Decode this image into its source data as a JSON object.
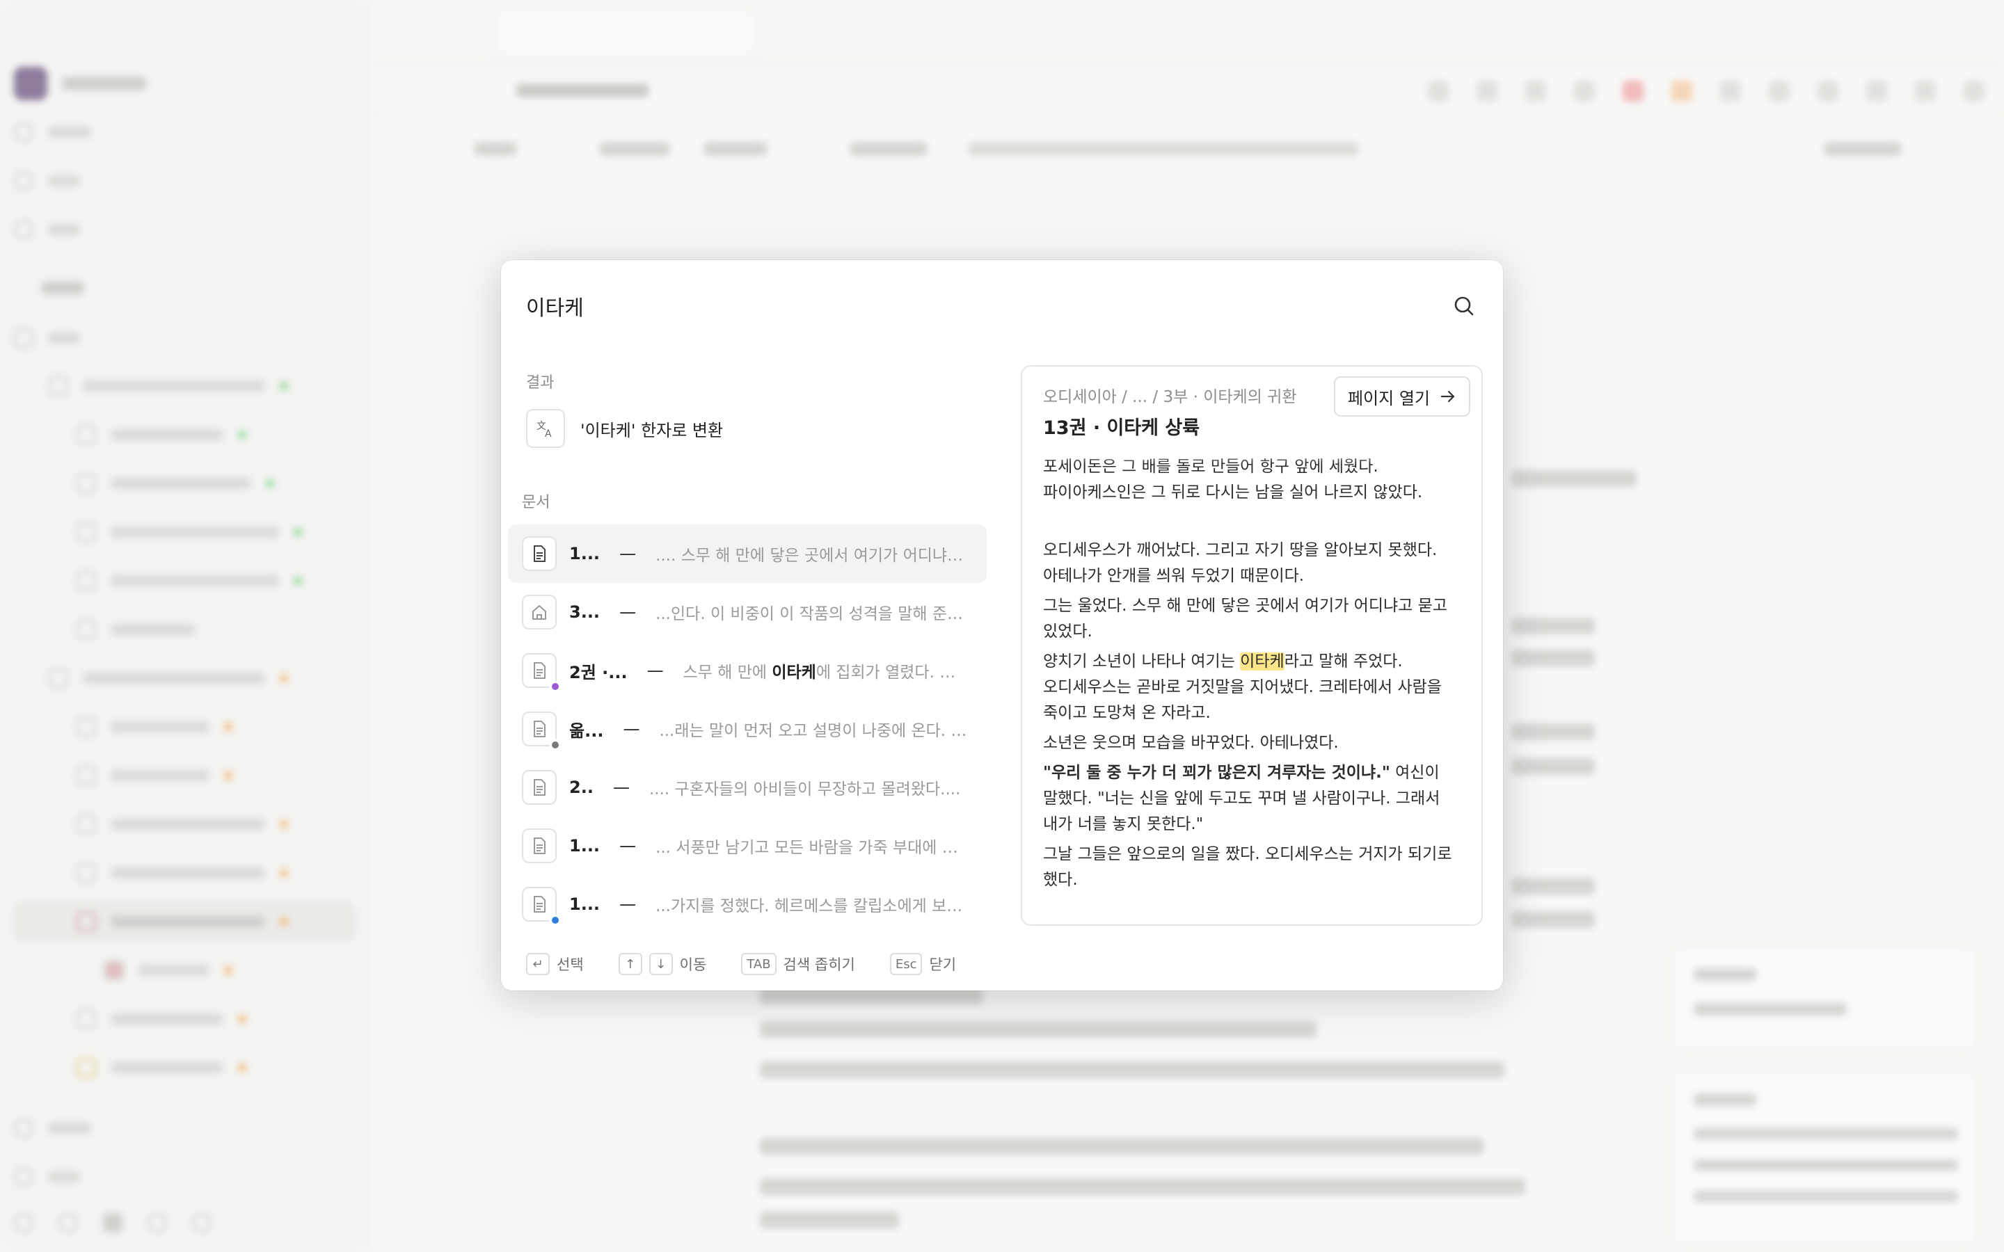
{
  "search": {
    "query": "이타케"
  },
  "sections": {
    "results_label": "결과",
    "documents_label": "문서"
  },
  "convert": {
    "label": "'이타케' 한자로 변환",
    "icon": "translate-icon"
  },
  "results": [
    {
      "title": "1...",
      "snippet": ".... 스무 해 만에 닿은 곳에서 여기가 어디냐고...",
      "icon": "document-icon",
      "status": null,
      "active": true
    },
    {
      "title": "3...",
      "snippet": "...인다. 이 비중이 이 작품의 성격을 말해 준다...",
      "icon": "home-icon",
      "status": null,
      "active": false
    },
    {
      "title": "2권 ·...",
      "snippet_pre": "스무 해 만에 ",
      "snippet_hit": "이타케",
      "snippet_post": "에 집회가 열렸다. 소집...",
      "icon": "document-icon",
      "status": "#9b59d6",
      "active": false
    },
    {
      "title": "옮...",
      "snippet": "...래는 말이 먼저 오고 설명이 나중에 온다. 이...",
      "icon": "document-icon",
      "status": "#7a7a7a",
      "active": false
    },
    {
      "title": "2..",
      "snippet": ".... 구혼자들의 아비들이 무장하고 몰려왔다....",
      "icon": "document-icon",
      "status": null,
      "active": false
    },
    {
      "title": "1...",
      "snippet": "... 서풍만 남기고 모든 바람을 가죽 부대에 묶...",
      "icon": "document-icon",
      "status": null,
      "active": false
    },
    {
      "title": "1...",
      "snippet": "...가지를 정했다. 헤르메스를 칼립소에게 보내...",
      "icon": "document-icon",
      "status": "#2f7ed8",
      "active": false
    }
  ],
  "footer": {
    "enter_key": "↵",
    "select_label": "선택",
    "up_key": "↑",
    "down_key": "↓",
    "move_label": "이동",
    "tab_key": "TAB",
    "narrow_label": "검색 좁히기",
    "esc_key": "Esc",
    "close_label": "닫기"
  },
  "preview": {
    "breadcrumb": "오디세이아 / ... / 3부 · 이타케의 귀환",
    "title": "13권 · 이타케 상륙",
    "open_button": "페이지 열기",
    "lines": {
      "l1": "포세이돈은 그 배를 돌로 만들어 항구 앞에 세웠다.",
      "l2": "파이아케스인은 그 뒤로 다시는 남을 실어 나르지 않았다.",
      "l3": "오디세우스가 깨어났다. 그리고 자기 땅을 알아보지 못했다.",
      "l4": "아테나가 안개를 씌워 두었기 때문이다.",
      "l5": "그는 울었다. 스무 해 만에 닿은 곳에서 여기가 어디냐고 묻고",
      "l6": "있었다.",
      "l7_pre": "양치기 소년이 나타나 여기는 ",
      "l7_hit": "이타케",
      "l7_post": "라고 말해 주었다.",
      "l8": "오디세우스는 곧바로 거짓말을 지어냈다. 크레타에서 사람을",
      "l9": "죽이고 도망쳐 온 자라고.",
      "l10": "소년은 웃으며 모습을 바꾸었다. 아테나였다.",
      "l11_bold": "\"우리 둘 중 누가 더 꾀가 많은지 겨루자는 것이냐.\"",
      "l11_post": " 여신이",
      "l12": "말했다. \"너는 신을 앞에 두고도 꾸며 낼 사람이구나. 그래서",
      "l13": "내가 너를 놓지 못한다.\"",
      "l14": "그날 그들은 앞으로의 일을 짰다. 오디세우스는 거지가 되기로",
      "l15": "했다."
    }
  },
  "colors": {
    "highlight": "#fde58a",
    "accent_purple": "#9b59d6",
    "accent_blue": "#2f7ed8"
  }
}
